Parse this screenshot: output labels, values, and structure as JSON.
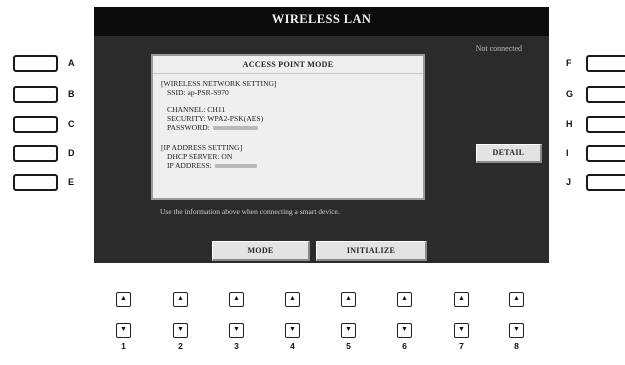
{
  "title": "WIRELESS LAN",
  "status": "Not connected",
  "panel": {
    "title": "ACCESS POINT MODE",
    "network_header": "[WIRELESS NETWORK SETTING]",
    "ssid": "SSID: ap-PSR-S970",
    "channel": "CHANNEL: CH11",
    "security": "SECURITY: WPA2-PSK(AES)",
    "password_label": "PASSWORD:",
    "ip_header": "[IP ADDRESS SETTING]",
    "dhcp": "DHCP SERVER: ON",
    "ip_label": "IP ADDRESS:"
  },
  "info": "Use the information above when connecting a smart device.",
  "buttons": {
    "mode": "MODE",
    "initialize": "INITIALIZE",
    "detail": "DETAIL"
  },
  "left_buttons": [
    "A",
    "B",
    "C",
    "D",
    "E"
  ],
  "right_buttons": [
    "F",
    "G",
    "H",
    "I",
    "J"
  ],
  "bottom_buttons": [
    "1",
    "2",
    "3",
    "4",
    "5",
    "6",
    "7",
    "8"
  ],
  "icons": {
    "up": "up-arrow-icon",
    "down": "down-arrow-icon"
  }
}
